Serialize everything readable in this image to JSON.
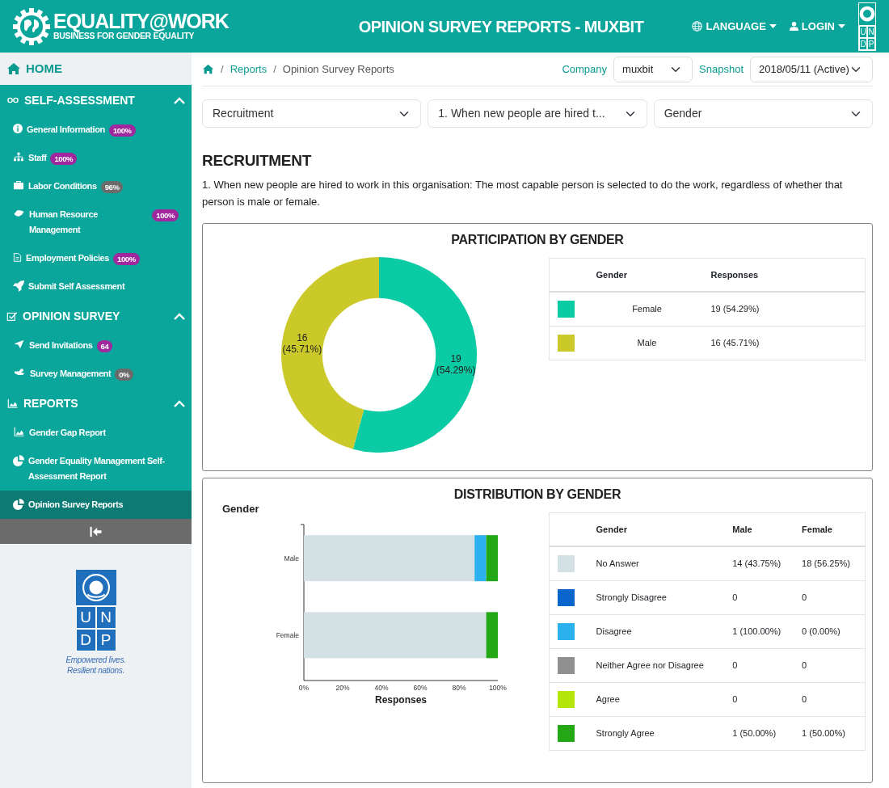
{
  "header": {
    "brand_title": "EQUALITY@WORK",
    "brand_subtitle": "BUSINESS FOR GENDER EQUALITY",
    "page_title": "OPINION SURVEY REPORTS - MUXBIT",
    "menus": [
      "LANGUAGE",
      "LOGIN"
    ],
    "logo_letters": [
      "U",
      "N",
      "D",
      "P"
    ]
  },
  "sidebar": {
    "home": "HOME",
    "sections": [
      {
        "title": "SELF-ASSESSMENT",
        "expanded": true,
        "items": [
          {
            "label": "General Information",
            "badge": "100%",
            "color": "#a0279e",
            "selected": false
          },
          {
            "label": "Staff",
            "badge": "100%",
            "color": "#a0279e",
            "selected": false
          },
          {
            "label": "Labor Conditions",
            "badge": "96%",
            "color": "#6b6b6b",
            "selected": false
          },
          {
            "label": "Human Resource Management",
            "badge": "100%",
            "color": "#a0279e",
            "selected": false
          },
          {
            "label": "Employment Policies",
            "badge": "100%",
            "color": "#a0279e",
            "selected": false
          },
          {
            "label": "Submit Self Assessment",
            "selected": false
          }
        ]
      },
      {
        "title": "OPINION SURVEY",
        "expanded": true,
        "items": [
          {
            "label": "Send Invitations",
            "badge": "64",
            "color": "#a0279e",
            "selected": false
          },
          {
            "label": "Survey Management",
            "badge": "0%",
            "color": "#6b6b6b",
            "selected": false
          }
        ]
      },
      {
        "title": "REPORTS",
        "expanded": true,
        "items": [
          {
            "label": "Gender Gap Report",
            "selected": false
          },
          {
            "label": "Gender Equality Management Self-Assessment Report",
            "selected": false
          },
          {
            "label": "Opinion Survey Reports",
            "selected": true
          }
        ]
      }
    ],
    "logo_letters": [
      "U",
      "N",
      "D",
      "P"
    ],
    "tagline": [
      "Empowered lives.",
      "Resilient nations."
    ]
  },
  "breadcrumb": {
    "separator": "/",
    "items": [
      "Reports",
      "Opinion Survey Reports"
    ]
  },
  "company": {
    "label": "Company",
    "value": "muxbit"
  },
  "snapshot": {
    "label": "Snapshot",
    "value": "2018/05/11 (Active)"
  },
  "filters": [
    "Recruitment",
    "1. When new people are hired t...",
    "Gender"
  ],
  "section_title": "RECRUITMENT",
  "question": "1. When new people are hired to work in this organisation: The most capable person is selected to do the work, regardless of whether that person is male or female.",
  "participation": {
    "title": "PARTICIPATION BY GENDER",
    "chart_data": {
      "type": "donut",
      "categories": [
        "Female",
        "Male"
      ],
      "values": [
        19,
        16
      ],
      "colors": [
        "#0acba3",
        "#cbc92a"
      ],
      "value_labels": [
        "19 (54.29%)",
        "16 (45.71%)"
      ]
    },
    "table": {
      "columns": [
        "Gender",
        "Responses"
      ],
      "rows": [
        {
          "responses": "19 (54.29%)"
        },
        {
          "responses": "16 (45.71%)"
        }
      ]
    }
  },
  "distribution": {
    "title": "DISTRIBUTION BY GENDER",
    "chart_data": {
      "type": "bar",
      "orientation": "horizontal",
      "stacked": true,
      "ylabel": "Gender",
      "xlabel": "Responses",
      "categories": [
        "Male",
        "Female"
      ],
      "xlim": [
        0,
        100
      ],
      "xticks": [
        {
          "value": 0,
          "label": "0%"
        },
        {
          "value": 20,
          "label": "20%"
        },
        {
          "value": 40,
          "label": "40%"
        },
        {
          "value": 60,
          "label": "60%"
        },
        {
          "value": 80,
          "label": "80%"
        },
        {
          "value": 100,
          "label": "100%"
        }
      ],
      "series": [
        {
          "name": "No Answer",
          "color": "#d3e1e5",
          "values": [
            88,
            94
          ]
        },
        {
          "name": "Strongly Disagree",
          "color": "#0a66cc",
          "values": [
            0,
            0
          ]
        },
        {
          "name": "Disagree",
          "color": "#2bb1ee",
          "values": [
            6,
            0
          ]
        },
        {
          "name": "Neither Agree nor Disagree",
          "color": "#8f8f8f",
          "values": [
            0,
            0
          ]
        },
        {
          "name": "Agree",
          "color": "#b4e60a",
          "values": [
            0,
            0
          ]
        },
        {
          "name": "Strongly Agree",
          "color": "#24a815",
          "values": [
            6,
            6
          ]
        }
      ]
    },
    "table": {
      "columns": [
        "Gender",
        "Male",
        "Female"
      ],
      "rows": [
        {
          "male": "14 (43.75%)",
          "female": "18 (56.25%)"
        },
        {
          "male": "0",
          "female": "0"
        },
        {
          "male": "1 (100.00%)",
          "female": "0 (0.00%)"
        },
        {
          "male": "0",
          "female": "0"
        },
        {
          "male": "0",
          "female": "0"
        },
        {
          "male": "1 (50.00%)",
          "female": "1 (50.00%)"
        }
      ]
    }
  }
}
